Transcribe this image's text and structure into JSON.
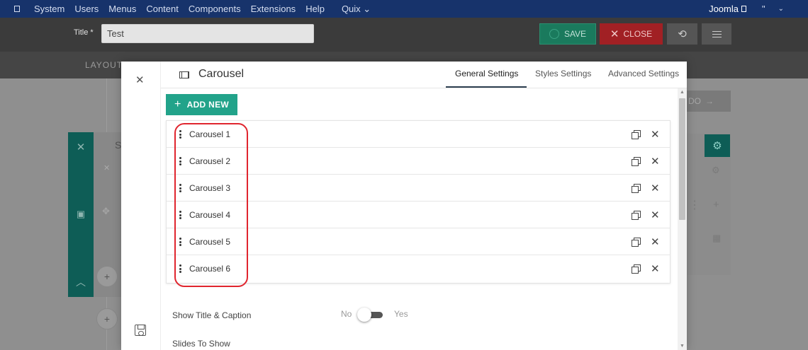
{
  "topbar": {
    "items": [
      "System",
      "Users",
      "Menus",
      "Content",
      "Components",
      "Extensions",
      "Help",
      "Quix ⌄"
    ],
    "site_name": "Joomla",
    "user_dots": "\"",
    "caret": "⌄"
  },
  "toolbar": {
    "title_label": "Title *",
    "title_value": "Test",
    "save_label": "SAVE",
    "close_label": "CLOSE"
  },
  "builder": {
    "layout_tab": "LAYOUT",
    "section_letter": "S",
    "next_label": "DO"
  },
  "modal": {
    "title": "Carousel",
    "tabs": [
      {
        "label": "General Settings",
        "active": true
      },
      {
        "label": "Styles Settings",
        "active": false
      },
      {
        "label": "Advanced Settings",
        "active": false
      }
    ],
    "add_new_label": "ADD NEW",
    "items": [
      {
        "label": "Carousel 1"
      },
      {
        "label": "Carousel 2"
      },
      {
        "label": "Carousel 3"
      },
      {
        "label": "Carousel 4"
      },
      {
        "label": "Carousel 5"
      },
      {
        "label": "Carousel 6"
      }
    ],
    "settings": {
      "show_title_caption": {
        "label": "Show Title & Caption",
        "no": "No",
        "yes": "Yes",
        "value": false
      },
      "slides_to_show": {
        "label": "Slides To Show"
      }
    }
  },
  "colors": {
    "topbar": "#17336b",
    "accent": "#22a38a",
    "danger": "#a12024",
    "highlight": "#e0252e"
  }
}
